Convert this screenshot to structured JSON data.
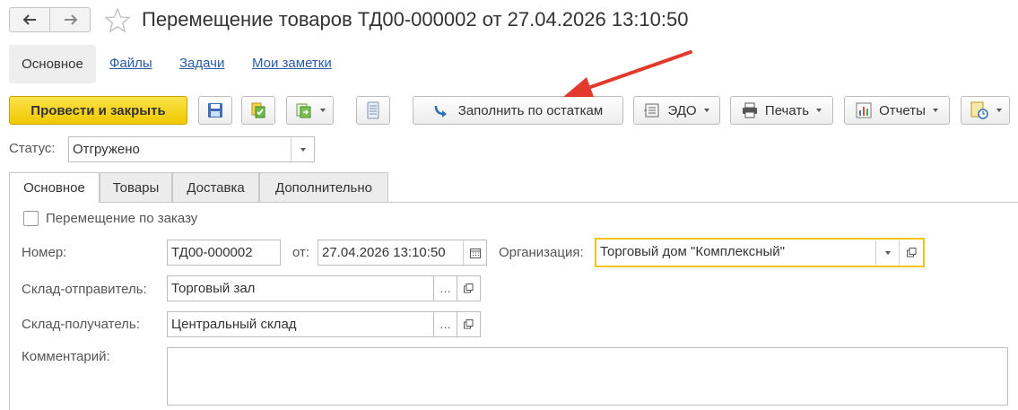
{
  "window": {
    "title": "Перемещение товаров ТД00-000002 от 27.04.2026 13:10:50"
  },
  "nav_tabs": [
    {
      "label": "Основное"
    },
    {
      "label": "Файлы"
    },
    {
      "label": "Задачи"
    },
    {
      "label": "Мои заметки"
    }
  ],
  "toolbar": {
    "post_close_label": "Провести и закрыть",
    "fill_label": "Заполнить по остаткам",
    "edo_label": "ЭДО",
    "print_label": "Печать",
    "reports_label": "Отчеты"
  },
  "status": {
    "label": "Статус:",
    "value": "Отгружено"
  },
  "form_tabs": [
    {
      "label": "Основное"
    },
    {
      "label": "Товары"
    },
    {
      "label": "Доставка"
    },
    {
      "label": "Дополнительно"
    }
  ],
  "form": {
    "by_order_label": "Перемещение по заказу",
    "number_label": "Номер:",
    "number_value": "ТД00-000002",
    "date_label": "от:",
    "date_value": "27.04.2026 13:10:50",
    "org_label": "Организация:",
    "org_value": "Торговый дом \"Комплексный\"",
    "sender_label": "Склад-отправитель:",
    "sender_value": "Торговый зал",
    "receiver_label": "Склад-получатель:",
    "receiver_value": "Центральный склад",
    "comment_label": "Комментарий:",
    "comment_value": ""
  },
  "colors": {
    "primary_button": "#f5d31b",
    "link": "#2a5ca8",
    "focus_border": "#f0c419",
    "annotation_arrow": "#e23b2e"
  }
}
